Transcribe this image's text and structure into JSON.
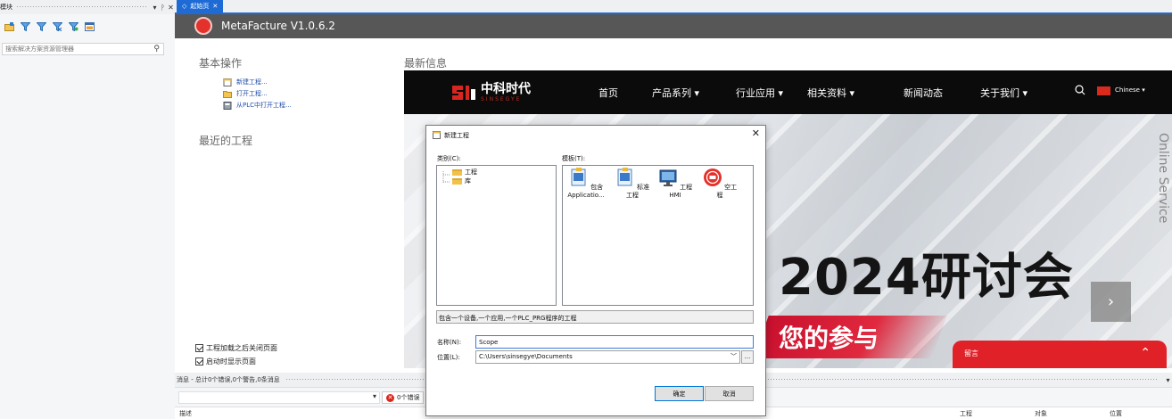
{
  "left_panel": {
    "title": "模块",
    "search_placeholder": "搜索解决方案资源管理器"
  },
  "tabs": [
    {
      "label": "起始页"
    }
  ],
  "header": {
    "title": "MetaFacture V1.0.6.2"
  },
  "basic_ops": {
    "title": "基本操作",
    "items": [
      {
        "label": "新建工程..."
      },
      {
        "label": "打开工程..."
      },
      {
        "label": "从PLC中打开工程..."
      }
    ]
  },
  "recent": {
    "title": "最近的工程"
  },
  "latest": {
    "title": "最新信息"
  },
  "options": {
    "close_after_load": "工程加载之后关闭页面",
    "show_on_startup": "启动时显示页面"
  },
  "website": {
    "logo_cn": "中科时代",
    "logo_en": "SINSEGYE",
    "nav": [
      "首页",
      "产品系列 ▾",
      "行业应用 ▾",
      "相关资料 ▾",
      "新闻动态",
      "关于我们 ▾"
    ],
    "lang": "Chinese ▾",
    "banner_title": "2024研讨会",
    "banner_sub": "您的参与",
    "online_service": "Online Service",
    "chat_label": "留言",
    "colors": {
      "brand_red": "#e02128",
      "nav_bg": "#0b0b0b"
    }
  },
  "messages": {
    "title": "消息 - 总计0个错误,0个警告,0条消息",
    "error_filter": "0个错误",
    "columns": {
      "description": "描述",
      "project": "工程",
      "object": "对象",
      "position": "位置"
    }
  },
  "dialog": {
    "title": "新建工程",
    "categories_label": "类别(C):",
    "templates_label": "模板(T):",
    "categories": [
      {
        "label": "工程"
      },
      {
        "label": "库"
      }
    ],
    "templates": [
      {
        "label": "包含 Applicatio..."
      },
      {
        "label": "标准工程"
      },
      {
        "label": "工程 HMI"
      },
      {
        "label": "空工程"
      }
    ],
    "description": "包含一个设备,一个应用,一个PLC_PRG程序的工程",
    "name_label": "名称(N):",
    "name_value": "Scope",
    "location_label": "位置(L):",
    "location_value": "C:\\Users\\sinsegye\\Documents",
    "browse_label": "...",
    "ok_label": "确定",
    "cancel_label": "取消"
  },
  "accent_color": "#1e6bd6"
}
